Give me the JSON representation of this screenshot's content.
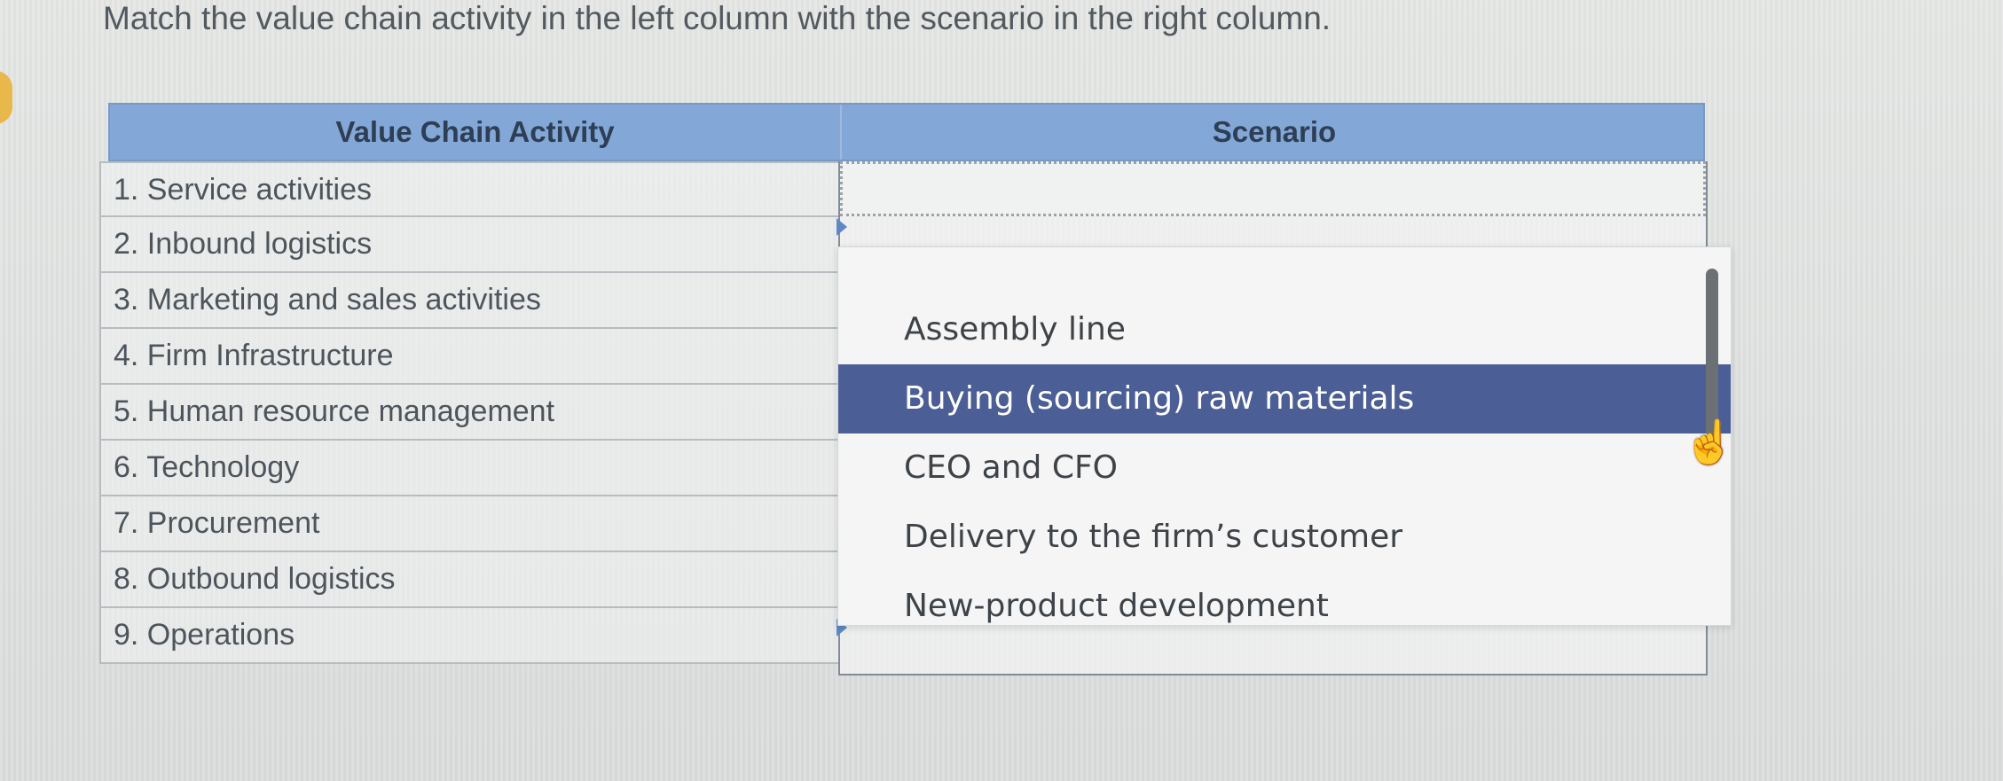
{
  "question": "Match the value chain activity in the left column with the scenario in the right column.",
  "table": {
    "headers": {
      "activity": "Value Chain Activity",
      "scenario": "Scenario"
    },
    "activities": [
      "1. Service activities",
      "2. Inbound logistics",
      "3. Marketing and sales activities",
      "4. Firm Infrastructure",
      "5. Human resource management",
      "6. Technology",
      "7. Procurement",
      "8. Outbound logistics",
      "9. Operations"
    ]
  },
  "dropdown": {
    "selected_value": "",
    "options": [
      "Assembly line",
      "Buying (sourcing) raw materials",
      "CEO and CFO",
      "Delivery to the firm’s customer",
      "New-product development"
    ],
    "highlighted_option": "Buying (sourcing) raw materials"
  },
  "colors": {
    "header": "#83a7d7",
    "highlight": "#4c5e96",
    "caret": "#4e7fc0"
  },
  "icons": {
    "dropdown": "chevron-down-icon",
    "cursor": "hand-cursor-icon"
  }
}
